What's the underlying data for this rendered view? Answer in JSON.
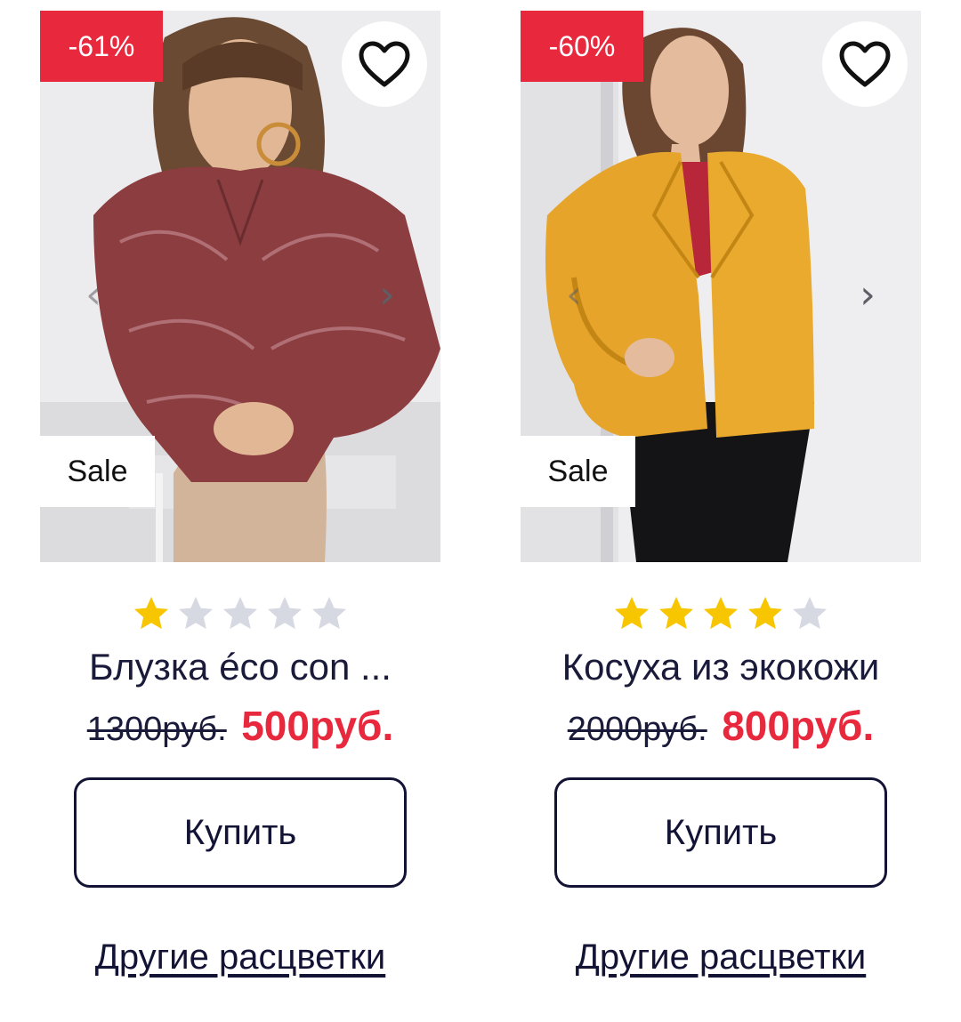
{
  "colors": {
    "accent_red": "#e8283c",
    "navy": "#131336",
    "star_filled": "#f7c600",
    "star_empty": "#d6d8e2"
  },
  "icons": {
    "favorite": "heart-outline-icon",
    "prev": "chevron-left-icon",
    "next": "chevron-right-icon",
    "star": "star-icon"
  },
  "products": [
    {
      "discount": "-61%",
      "sale_label": "Sale",
      "rating": 1,
      "rating_max": 5,
      "title": "Блузка éco con ...",
      "old_price": "1300руб.",
      "new_price": "500руб.",
      "buy_label": "Купить",
      "colors_link": "Другие расцветки",
      "nav_prev": "‹",
      "nav_next": "›"
    },
    {
      "discount": "-60%",
      "sale_label": "Sale",
      "rating": 4,
      "rating_max": 5,
      "title": "Косуха из экокожи",
      "old_price": "2000руб.",
      "new_price": "800руб.",
      "buy_label": "Купить",
      "colors_link": "Другие расцветки",
      "nav_prev": "‹",
      "nav_next": "›"
    }
  ]
}
